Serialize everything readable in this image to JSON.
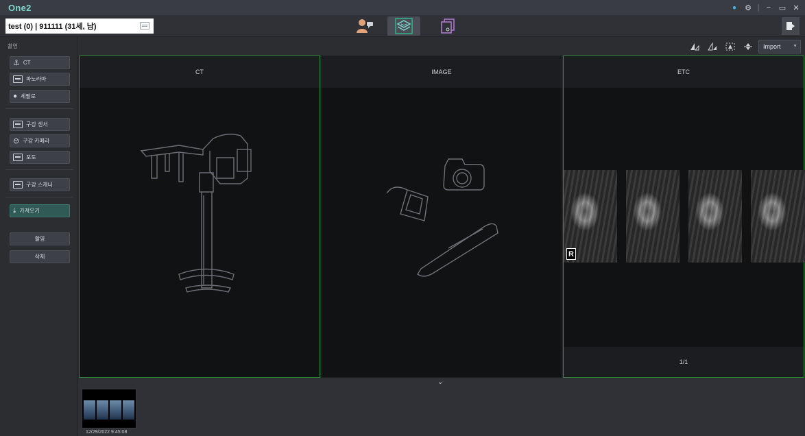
{
  "app": {
    "title": "One2"
  },
  "window": {
    "controls": [
      "●",
      "⚙",
      "|",
      "−",
      "▭",
      "✕"
    ]
  },
  "toolbar": {
    "patient": "test  (0) | 911111 (31세, 남)",
    "modes": [
      {
        "name": "patient-consult-icon",
        "active": false
      },
      {
        "name": "acquisition-layers-icon",
        "active": true
      },
      {
        "name": "viewer-window-icon",
        "active": false
      }
    ],
    "exit_icon": "exit-door-icon"
  },
  "sidebar": {
    "heading": "촬영",
    "buttons": {
      "ct": "CT",
      "panorama": "파노라마",
      "ceph": "세팔로",
      "intraoral_sensor": "구강 센서",
      "intraoral_camera": "구강 카메라",
      "photo": "포토",
      "intraoral_scanner": "구강 스캐너",
      "import": "가져오기",
      "capture": "촬영",
      "delete": "삭제"
    }
  },
  "tools": {
    "icons": [
      "flip-vertical-icon",
      "flip-horizontal-icon",
      "fit-icon",
      "arrange-icon"
    ],
    "import_select": "Import"
  },
  "panels": [
    {
      "title": "CT"
    },
    {
      "title": "IMAGE"
    },
    {
      "title": "ETC",
      "page": "1/1",
      "marker": "R"
    }
  ],
  "strip": {
    "collapse": "⌄",
    "thumbnail_date": "12/29/2022 9:45:08"
  },
  "colors": {
    "accent": "#7fd6cf",
    "selected_border": "#2f8a38",
    "import_btn": "#2f5a55"
  }
}
